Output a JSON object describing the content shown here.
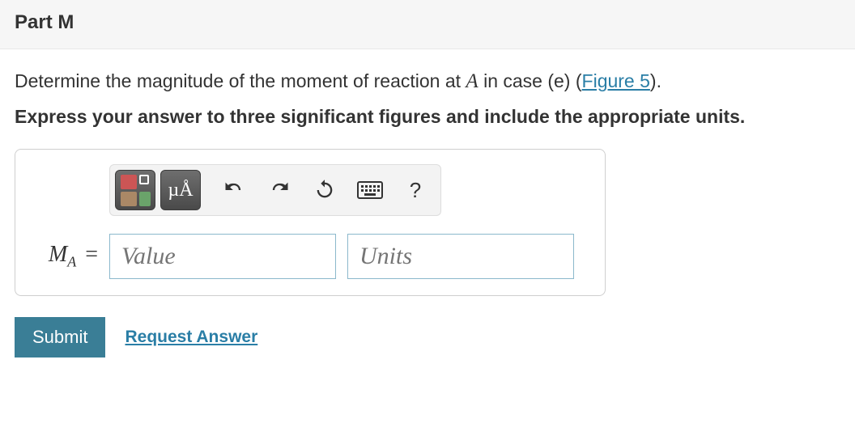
{
  "part": {
    "title": "Part M"
  },
  "question": {
    "prefix": "Determine the magnitude of the moment of reaction at ",
    "variable": "A",
    "middle": " in case (e) (",
    "figure_link": "Figure 5",
    "suffix": ")."
  },
  "instruction": "Express your answer to three significant figures and include the appropriate units.",
  "toolbar": {
    "templates_icon": "templates-icon",
    "special_chars": "µÅ",
    "undo_icon": "↶",
    "redo_icon": "↷",
    "reset_icon": "↻",
    "keyboard_icon": "⌨",
    "help_icon": "?"
  },
  "answer": {
    "variable": "M",
    "subscript": "A",
    "equals": "=",
    "value_placeholder": "Value",
    "units_placeholder": "Units"
  },
  "actions": {
    "submit_label": "Submit",
    "request_answer_label": "Request Answer"
  }
}
